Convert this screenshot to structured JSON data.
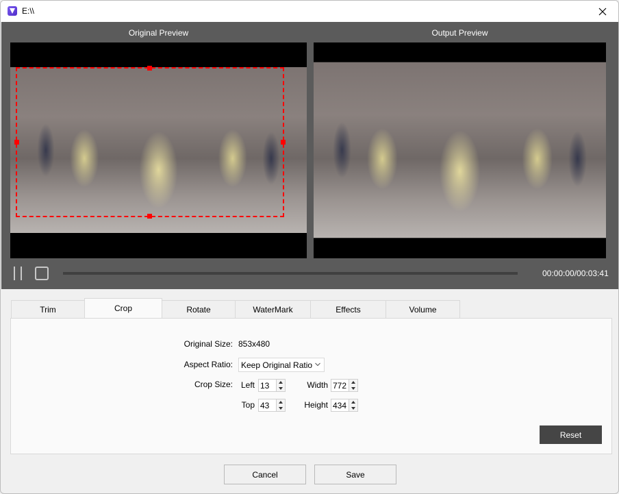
{
  "window": {
    "title": "E:\\\\",
    "app_icon": "app-logo-icon",
    "close_icon": "close-icon"
  },
  "preview": {
    "original_label": "Original Preview",
    "output_label": "Output Preview",
    "playback": {
      "pause_icon": "pause-icon",
      "stop_icon": "stop-icon",
      "progress": 0,
      "time": "00:00:00/00:03:41"
    }
  },
  "tabs": [
    {
      "label": "Trim",
      "active": false
    },
    {
      "label": "Crop",
      "active": true
    },
    {
      "label": "Rotate",
      "active": false
    },
    {
      "label": "WaterMark",
      "active": false
    },
    {
      "label": "Effects",
      "active": false
    },
    {
      "label": "Volume",
      "active": false
    }
  ],
  "crop": {
    "original_size_label": "Original Size:",
    "original_size_value": "853x480",
    "aspect_ratio_label": "Aspect Ratio:",
    "aspect_ratio_value": "Keep Original Ratio",
    "crop_size_label": "Crop Size:",
    "left_label": "Left",
    "left_value": "13",
    "top_label": "Top",
    "top_value": "43",
    "width_label": "Width",
    "width_value": "772",
    "height_label": "Height",
    "height_value": "434",
    "reset_label": "Reset"
  },
  "footer": {
    "cancel_label": "Cancel",
    "save_label": "Save"
  },
  "colors": {
    "crop_border": "#ff0000",
    "preview_bg": "#5b5b5b",
    "reset_bg": "#454545"
  }
}
